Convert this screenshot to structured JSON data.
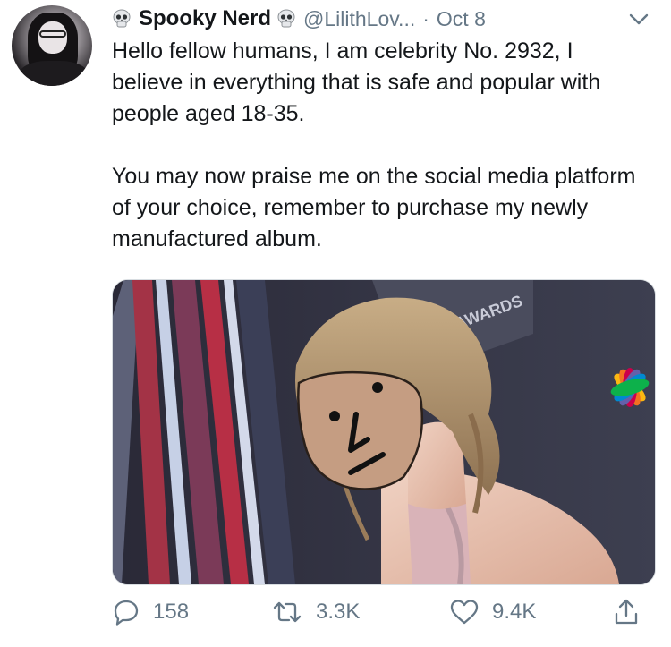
{
  "tweet": {
    "display_name": "Spooky Nerd",
    "handle": "@LilithLov...",
    "separator": "·",
    "date": "Oct 8",
    "paragraphs": [
      "Hello fellow humans, I am celebrity No. 2932, I believe in everything that is safe and popular with people aged 18-35.",
      "You may now praise me on the social media platform of your choice, remember to purchase my newly manufactured album."
    ],
    "media": {
      "backdrop_text": "AWARDS",
      "overlay": "npc-face"
    }
  },
  "actions": {
    "reply_count": "158",
    "retweet_count": "3.3K",
    "like_count": "9.4K"
  },
  "icons": {
    "name_prefix": "skull-icon",
    "name_suffix": "skull-icon",
    "caret": "chevron-down-icon",
    "reply": "reply-icon",
    "retweet": "retweet-icon",
    "like": "heart-icon",
    "share": "share-icon"
  },
  "colors": {
    "text": "#14171a",
    "secondary": "#657786"
  }
}
